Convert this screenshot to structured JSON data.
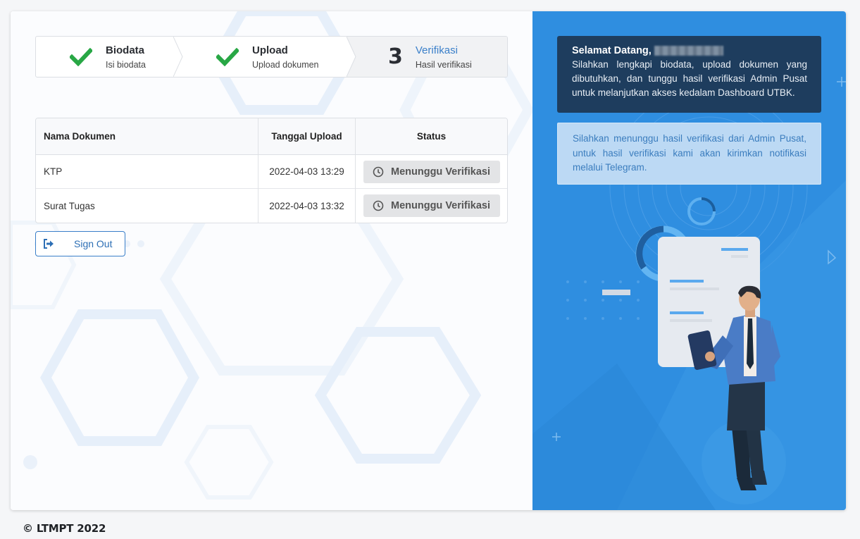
{
  "stepper": {
    "steps": [
      {
        "title": "Biodata",
        "subtitle": "Isi biodata",
        "state": "done"
      },
      {
        "title": "Upload",
        "subtitle": "Upload dokumen",
        "state": "done"
      },
      {
        "number": "3",
        "title": "Verifikasi",
        "subtitle": "Hasil verifikasi",
        "state": "active"
      }
    ]
  },
  "table": {
    "headers": [
      "Nama Dokumen",
      "Tanggal Upload",
      "Status"
    ],
    "rows": [
      {
        "name": "KTP",
        "date": "2022-04-03 13:29",
        "status": "Menunggu Verifikasi"
      },
      {
        "name": "Surat Tugas",
        "date": "2022-04-03 13:32",
        "status": "Menunggu Verifikasi"
      }
    ]
  },
  "signout": {
    "label": "Sign Out"
  },
  "welcome": {
    "greeting": "Selamat Datang,",
    "message": "Silahkan lengkapi biodata, upload dokumen yang dibutuhkan, dan tunggu hasil verifikasi Admin Pusat untuk melanjutkan akses kedalam Dashboard UTBK."
  },
  "notice": {
    "text": "Silahkan menunggu hasil verifikasi dari Admin Pusat, untuk hasil verifikasi kami akan kirimkan notifikasi melalui Telegram."
  },
  "footer": {
    "text": "© LTMPT 2022"
  },
  "colors": {
    "accent": "#3a7fc9",
    "success": "#28a745",
    "panel": "#2f8ee0",
    "welcome_bg": "#1e3d5e"
  },
  "icons": [
    "check-icon",
    "clock-icon",
    "sign-out-icon"
  ]
}
